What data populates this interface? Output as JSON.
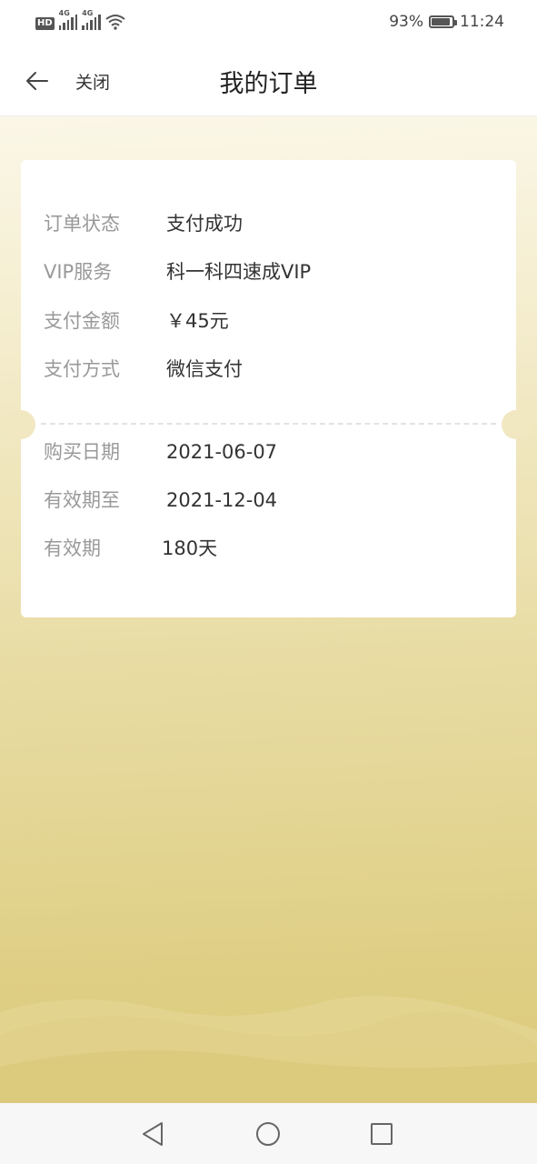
{
  "status_bar": {
    "hd_badge": "HD",
    "signal_1_label": "4G",
    "signal_2_label": "4G",
    "battery_percent": "93%",
    "battery_level": 0.93,
    "time": "11:24",
    "icons": [
      "hd-icon",
      "signal-icon",
      "signal-icon",
      "wifi-icon",
      "battery-icon"
    ]
  },
  "header": {
    "back_icon": "arrow-left-icon",
    "close_label": "关闭",
    "title": "我的订单"
  },
  "order": {
    "status": {
      "label": "订单状态",
      "value": "支付成功"
    },
    "vip_service": {
      "label": "VIP服务",
      "value": "科一科四速成VIP"
    },
    "amount": {
      "label": "支付金额",
      "value": "￥45元"
    },
    "payment_method": {
      "label": "支付方式",
      "value": "微信支付"
    },
    "purchase_date": {
      "label": "购买日期",
      "value": "2021-06-07"
    },
    "valid_until": {
      "label": "有效期至",
      "value": "2021-12-04"
    },
    "validity": {
      "label": "有效期",
      "value": "180天"
    }
  },
  "nav_bar": {
    "buttons": [
      "back-triangle-icon",
      "home-circle-icon",
      "recents-square-icon"
    ]
  },
  "colors": {
    "label": "#999999",
    "value": "#333333",
    "background_top": "#fbf7e8",
    "background_bottom": "#dccb7c"
  }
}
